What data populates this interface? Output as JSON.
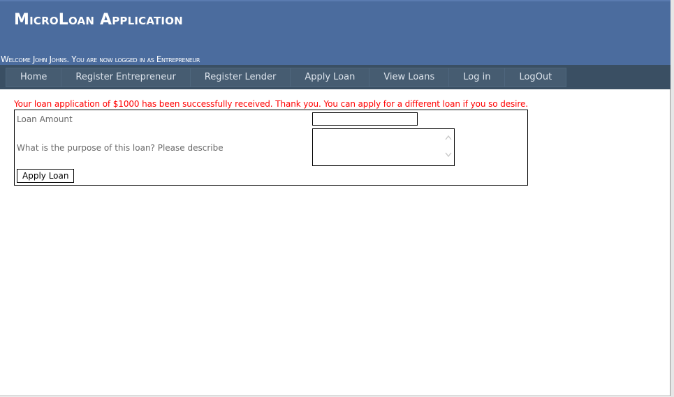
{
  "header": {
    "title": "MicroLoan Application",
    "welcome": "Welcome John Johns. You are now logged in as Entrepreneur"
  },
  "menu": {
    "items": [
      {
        "label": "Home"
      },
      {
        "label": "Register Entrepreneur"
      },
      {
        "label": "Register Lender"
      },
      {
        "label": "Apply Loan"
      },
      {
        "label": "View Loans"
      },
      {
        "label": "Log in"
      },
      {
        "label": "LogOut"
      }
    ]
  },
  "status": {
    "message": "Your loan application of $1000 has been successfully received. Thank you. You can apply for a different loan if you so desire."
  },
  "form": {
    "amount_label": "Loan Amount",
    "amount_value": "",
    "purpose_label": "What is the purpose of this loan? Please describe",
    "purpose_value": "",
    "submit_label": "Apply Loan"
  },
  "colors": {
    "header_bg": "#4b6c9e",
    "menubar_bg": "#3a4f63",
    "menu_bg": "#465c71",
    "message_color": "#ff0000",
    "label_color": "#696969"
  },
  "icons": {
    "scroll_up": "chevron-up-icon",
    "scroll_down": "chevron-down-icon"
  }
}
